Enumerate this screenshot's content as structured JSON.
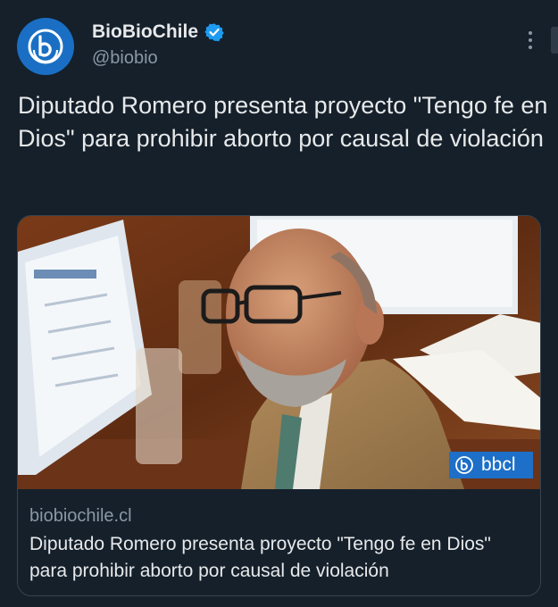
{
  "account": {
    "display_name": "BioBioChile",
    "handle": "@biobio",
    "verified": true,
    "avatar_icon": "biobio-logo-icon",
    "brand_color": "#1a6fc4"
  },
  "tweet": {
    "text": "Diputado Romero presenta proyecto \"Tengo fe en Dios\" para prohibir aborto por causal de violación"
  },
  "card": {
    "image_watermark": "bbcl",
    "domain": "biobiochile.cl",
    "title": "Diputado Romero presenta proyecto \"Tengo fe en Dios\" para prohibir aborto por causal de violación"
  },
  "colors": {
    "background": "#15202b",
    "text_primary": "#e7e9ea",
    "text_secondary": "#8b98a5",
    "verified": "#1d9bf0",
    "border": "#38444d"
  }
}
